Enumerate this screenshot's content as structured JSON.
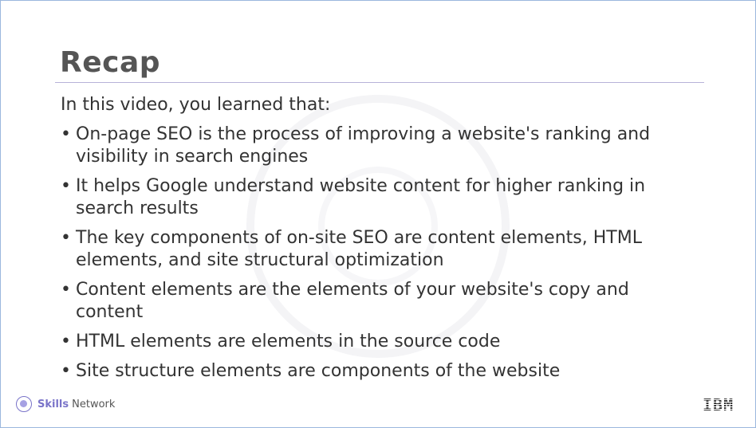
{
  "slide": {
    "title": "Recap",
    "intro": "In this video, you learned that:",
    "bullets": [
      "On-page SEO is the process of improving a website's ranking and visibility in search engines",
      "It helps Google understand website content for higher ranking in search results",
      "The key components of on-site SEO are content elements, HTML elements, and site structural optimization",
      "Content elements are the elements of your website's copy and content",
      "HTML elements are elements in the source code",
      "Site structure elements are components of the website"
    ],
    "bullet_symbol": "•"
  },
  "footer": {
    "brand_bold": "Skills",
    "brand_light": "Network",
    "brand_icon": "skills-network-logo-icon",
    "ibm_logo": "IBM"
  },
  "colors": {
    "title": "#555555",
    "rule": "#b7b2d9",
    "text": "#333333",
    "brand": "#7a74c9",
    "frame_border": "#9bb7dd"
  }
}
